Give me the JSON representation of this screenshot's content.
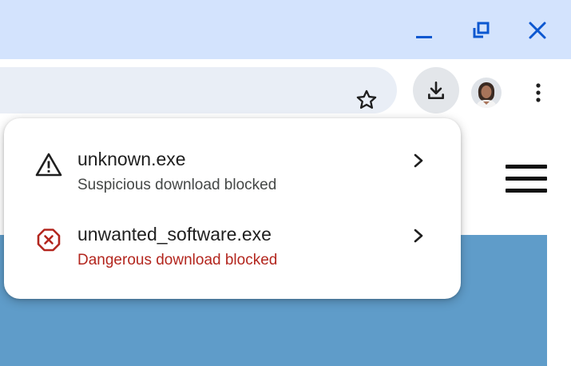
{
  "window_controls": {
    "icons": [
      "minimize-icon",
      "restore-icon",
      "close-icon"
    ],
    "accent_color": "#0b57d0"
  },
  "toolbar": {
    "icons": [
      "bookmark-star-icon",
      "download-icon",
      "profile-avatar",
      "more-vert-icon"
    ]
  },
  "downloads_bubble": {
    "items": [
      {
        "filename": "unknown.exe",
        "status": "Suspicious download blocked",
        "icon": "warning-triangle-icon",
        "status_color": "#444746"
      },
      {
        "filename": "unwanted_software.exe",
        "status": "Dangerous download blocked",
        "icon": "dangerous-octagon-icon",
        "status_color": "#b3261e"
      }
    ]
  },
  "page": {
    "icons": [
      "hamburger-menu-icon"
    ],
    "hero_color": "#5f9cc9"
  }
}
